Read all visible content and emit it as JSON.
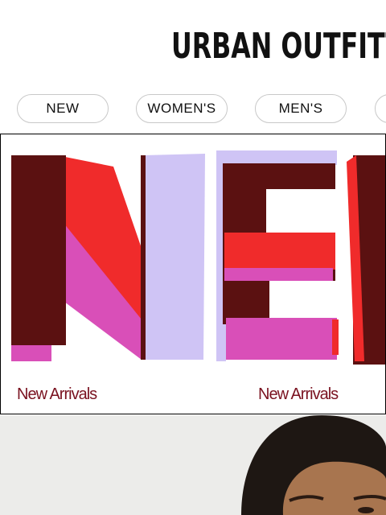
{
  "header": {
    "logo_text": "URBAN OUTFITTERS"
  },
  "nav": {
    "items": [
      {
        "label": "NEW"
      },
      {
        "label": "WOMEN'S"
      },
      {
        "label": "MEN'S"
      },
      {
        "label": ""
      }
    ]
  },
  "promo": {
    "labels": [
      "New Arrivals",
      "New Arrivals"
    ],
    "colors": {
      "maroon": "#5b1111",
      "red": "#f02b2b",
      "magenta": "#d94fb8",
      "lavender": "#cfc4f5",
      "label": "#7a1220"
    }
  },
  "photo": {
    "background": "#ececea"
  }
}
